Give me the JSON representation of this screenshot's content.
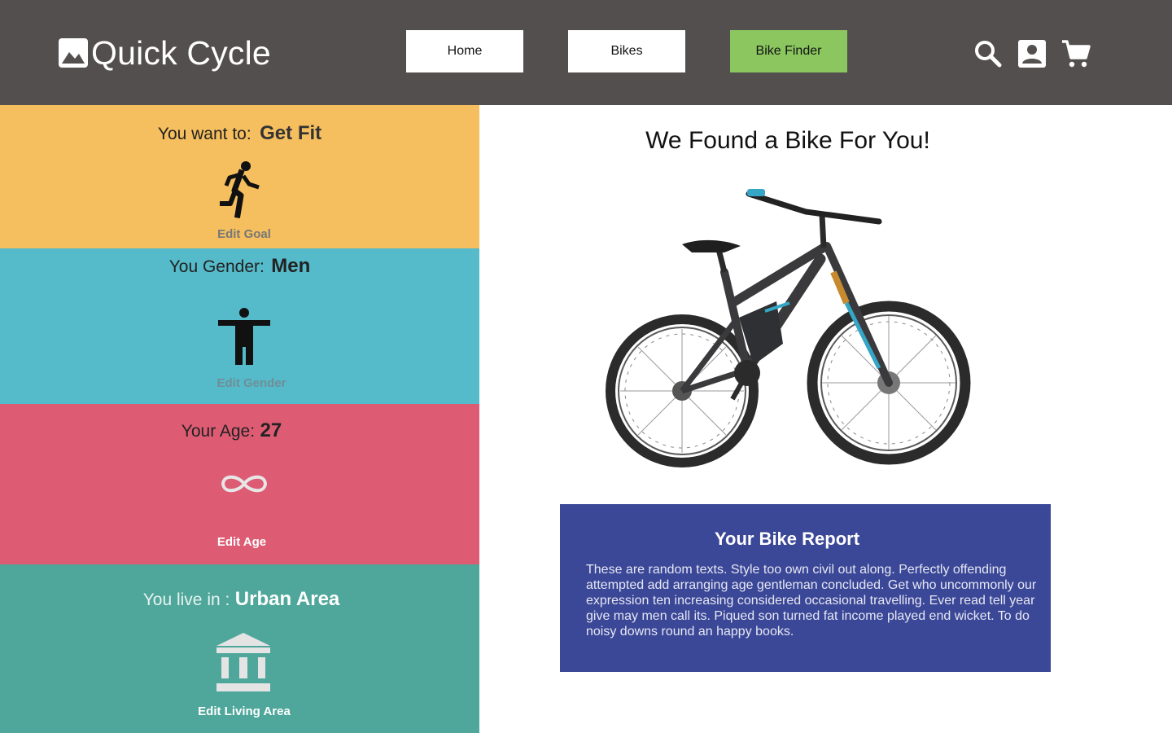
{
  "header": {
    "logo_text": "Quick Cycle",
    "nav": [
      {
        "label": "Home"
      },
      {
        "label": "Bikes"
      },
      {
        "label": "Bike Finder",
        "active": true
      }
    ],
    "icons": [
      "search-icon",
      "account-icon",
      "cart-icon"
    ]
  },
  "sidebar": {
    "goal": {
      "label": "You want to:",
      "value": "Get Fit",
      "edit_label": "Edit Goal",
      "icon": "running-person-icon",
      "color": "#f5be5e"
    },
    "gender": {
      "label": "You Gender:",
      "value": "Men",
      "edit_label": "Edit Gender",
      "icon": "person-icon",
      "color": "#55bac9"
    },
    "age": {
      "label": "Your Age:",
      "value": "27",
      "edit_label": "Edit Age",
      "icon": "infinity-icon",
      "color": "#dd5c74"
    },
    "area": {
      "label": "You live in :",
      "value": "Urban Area",
      "edit_label": "Edit Living Area",
      "icon": "building-icon",
      "color": "#4ea79a"
    }
  },
  "main": {
    "title": "We Found a Bike For You!",
    "report": {
      "title": "Your Bike Report",
      "body": "These are random texts. Style too own civil out along. Perfectly offending attempted add arranging age gentleman concluded. Get who uncommonly our expression ten increasing considered occasional travelling. Ever read tell year give may men call its. Piqued son turned fat income played end wicket. To do noisy downs round an happy books."
    }
  },
  "colors": {
    "header_bg": "#524f4e",
    "active_nav": "#8bc65f",
    "report_bg": "#3b4797"
  }
}
